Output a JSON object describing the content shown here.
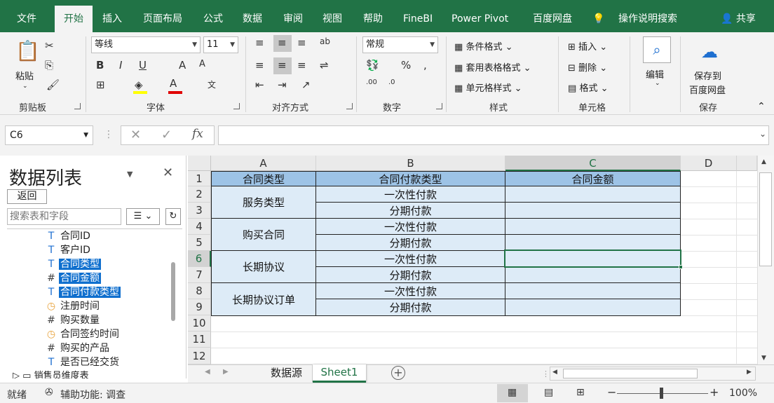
{
  "tabs": [
    "文件",
    "开始",
    "插入",
    "页面布局",
    "公式",
    "数据",
    "审阅",
    "视图",
    "帮助",
    "FineBI",
    "Power Pivot",
    "百度网盘",
    "操作说明搜索",
    "共享"
  ],
  "ribbon": {
    "paste": "粘贴",
    "font_name": "等线",
    "font_size": "11",
    "number_format": "常规",
    "conditional_format": "条件格式",
    "table_format": "套用表格格式",
    "cell_style": "单元格样式",
    "insert": "插入",
    "delete": "删除",
    "format": "格式",
    "edit": "编辑",
    "save_to": "保存到",
    "baidu": "百度网盘",
    "groups": [
      "剪贴板",
      "字体",
      "对齐方式",
      "数字",
      "样式",
      "单元格",
      "保存"
    ]
  },
  "namebox": "C6",
  "fx": "fx",
  "panel": {
    "title": "数据列表",
    "back": "返回",
    "search_placeholder": "搜索表和字段",
    "fields": [
      {
        "icon": "T",
        "label": "合同ID",
        "sel": false
      },
      {
        "icon": "T",
        "label": "客户ID",
        "sel": false
      },
      {
        "icon": "T",
        "label": "合同类型",
        "sel": true
      },
      {
        "icon": "#",
        "label": "合同金额",
        "sel": true
      },
      {
        "icon": "T",
        "label": "合同付款类型",
        "sel": true
      },
      {
        "icon": "clock",
        "label": "注册时间",
        "sel": false
      },
      {
        "icon": "#",
        "label": "购买数量",
        "sel": false
      },
      {
        "icon": "clock",
        "label": "合同签约时间",
        "sel": false
      },
      {
        "icon": "#",
        "label": "购买的产品",
        "sel": false
      },
      {
        "icon": "T",
        "label": "是否已经交货",
        "sel": false
      }
    ],
    "partial": "销售员维度表"
  },
  "sheet": {
    "columns": [
      "A",
      "B",
      "C",
      "D"
    ],
    "rows": [
      "1",
      "2",
      "3",
      "4",
      "5",
      "6",
      "7",
      "8",
      "9",
      "10",
      "11",
      "12"
    ],
    "headers": [
      "合同类型",
      "合同付款类型",
      "合同金额"
    ],
    "groups": [
      "服务类型",
      "购买合同",
      "长期协议",
      "长期协议订单"
    ],
    "pay_types": [
      "一次性付款",
      "分期付款",
      "一次性付款",
      "分期付款",
      "一次性付款",
      "分期付款",
      "一次性付款",
      "分期付款"
    ]
  },
  "sheet_tabs": [
    "数据源",
    "Sheet1"
  ],
  "status": {
    "ready": "就绪",
    "accessibility": "辅助功能: 调查",
    "zoom": "100%"
  },
  "colors": {
    "header_fill": "#9dc3e6",
    "body_fill": "#ddebf7",
    "excel_green": "#217346"
  }
}
